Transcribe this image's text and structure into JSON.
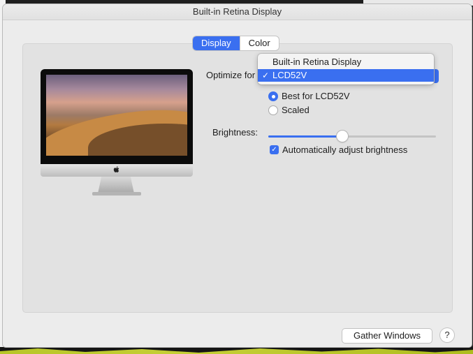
{
  "window": {
    "title": "Built-in Retina Display"
  },
  "tabs": [
    {
      "label": "Display",
      "active": true
    },
    {
      "label": "Color",
      "active": false
    }
  ],
  "optimize": {
    "label": "Optimize for",
    "options": [
      "Built-in Retina Display",
      "LCD52V"
    ],
    "selected": "LCD52V",
    "check_glyph": "✓"
  },
  "resolution": {
    "options": [
      {
        "label": "Best for LCD52V",
        "selected": true
      },
      {
        "label": "Scaled",
        "selected": false
      }
    ]
  },
  "brightness": {
    "label": "Brightness:",
    "value": 0.44
  },
  "auto_brightness": {
    "label": "Automatically adjust brightness",
    "checked": true,
    "check_glyph": "✓"
  },
  "buttons": {
    "gather": "Gather Windows",
    "help": "?"
  },
  "icons": {
    "apple_logo": "apple-logo-icon"
  },
  "colors": {
    "accent": "#3a6ff0",
    "panel": "#e2e2e2",
    "window": "#ececec"
  }
}
